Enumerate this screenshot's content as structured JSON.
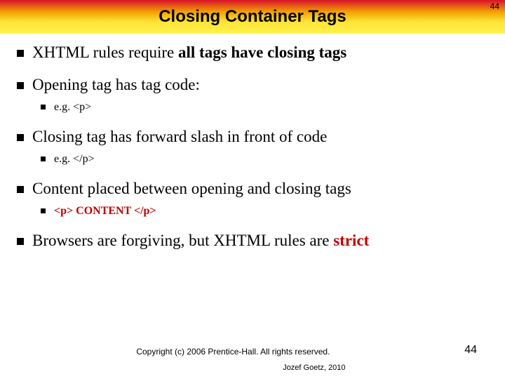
{
  "header": {
    "title": "Closing Container Tags",
    "page_number_top": "44"
  },
  "bullets": [
    {
      "prefix": "XHTML rules require ",
      "emph": "all tags have closing tags",
      "suffix": "",
      "emph_bold": true
    },
    {
      "prefix": "Opening tag has tag code:",
      "sub": {
        "text": "e.g. <p>"
      }
    },
    {
      "prefix": "Closing tag has forward slash in front of code",
      "sub": {
        "text": "e.g. </p>"
      }
    },
    {
      "prefix": "Content placed between opening and closing tags",
      "sub": {
        "red": "<p>  CONTENT  </p>"
      }
    },
    {
      "prefix": "Browsers are forgiving, but XHTML rules are ",
      "strict": "strict"
    }
  ],
  "footer": {
    "copyright": "Copyright (c) 2006 Prentice-Hall. All rights reserved.",
    "author": "Jozef Goetz, 2010",
    "page_number_bottom": "44"
  }
}
